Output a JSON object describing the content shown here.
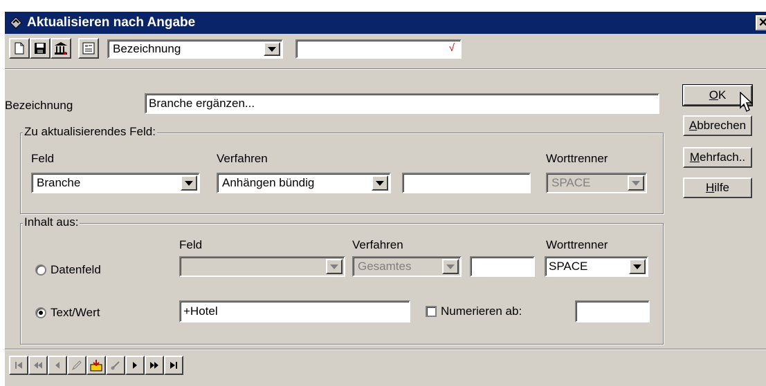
{
  "window": {
    "title": "Aktualisieren nach Angabe",
    "close_label": "✕"
  },
  "toolbar": {
    "icons": [
      "new-document-icon",
      "save-icon",
      "delete-icon",
      "properties-icon"
    ],
    "select_value": "Bezeichnung",
    "search_value": "",
    "check_mark": "√"
  },
  "bezeichnung": {
    "label": "Bezeichnung",
    "value": "Branche ergänzen..."
  },
  "update_group": {
    "title": "Zu aktualisierendes Feld:",
    "feld_label": "Feld",
    "verfahren_label": "Verfahren",
    "worttrenner_label": "Worttrenner",
    "feld_value": "Branche",
    "verfahren_value": "Anhängen bündig",
    "extra_value": "",
    "worttrenner_value": "SPACE"
  },
  "content_group": {
    "title": "Inhalt aus:",
    "feld_label": "Feld",
    "verfahren_label": "Verfahren",
    "worttrenner_label": "Worttrenner",
    "datenfeld_label": "Datenfeld",
    "datenfeld_feld_value": "",
    "datenfeld_verfahren_value": "Gesamtes",
    "datenfeld_extra_value": "",
    "worttrenner_value": "SPACE",
    "textwert_label": "Text/Wert",
    "textwert_value": "+Hotel",
    "numerieren_label": "Numerieren ab:",
    "numerieren_value": ""
  },
  "buttons": {
    "ok": {
      "key": "O",
      "rest": "K"
    },
    "abbrechen": {
      "key": "A",
      "rest": "bbrechen"
    },
    "mehrfach": {
      "key": "M",
      "rest": "ehrfach.."
    },
    "hilfe": {
      "key": "H",
      "rest": "ilfe"
    }
  },
  "colors": {
    "titlebar": "#0a246a",
    "face": "#d4d0c8",
    "accent_red": "#cc0000"
  }
}
